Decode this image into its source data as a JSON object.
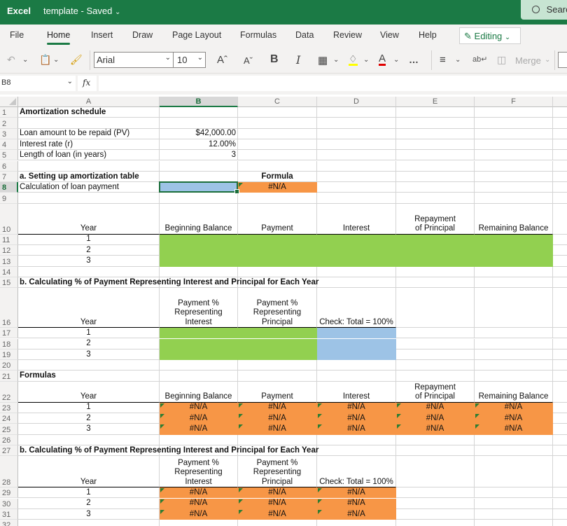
{
  "titlebar": {
    "app": "Excel",
    "doc_name": "template",
    "separator": "-",
    "status": "Saved",
    "search": "Search"
  },
  "tabs": [
    {
      "label": "File"
    },
    {
      "label": "Home",
      "active": true
    },
    {
      "label": "Insert"
    },
    {
      "label": "Draw"
    },
    {
      "label": "Page Layout"
    },
    {
      "label": "Formulas"
    },
    {
      "label": "Data"
    },
    {
      "label": "Review"
    },
    {
      "label": "View"
    },
    {
      "label": "Help"
    }
  ],
  "editing_mode": "Editing",
  "toolbar": {
    "font_name": "Arial",
    "font_size": "10",
    "bold": "B",
    "italic": "I",
    "more": "…",
    "merge": "Merge",
    "colors": {
      "highlight": "#ffff00",
      "font_color": "#e00000"
    }
  },
  "formula_bar": {
    "name_box": "B8",
    "fx": "fx",
    "content": ""
  },
  "columns": [
    "A",
    "B",
    "C",
    "D",
    "E",
    "F"
  ],
  "selected_cell": "B8",
  "colors": {
    "green_fill": "#92d050",
    "blue_fill": "#9dc3e6",
    "orange_fill": "#f79646",
    "excel_green": "#1b7a45"
  },
  "sheet": {
    "r1": {
      "A": "Amortization schedule"
    },
    "r3": {
      "A": "Loan amount to be repaid (PV)",
      "B": "$42,000.00"
    },
    "r4": {
      "A": "Interest rate  (r)",
      "B": "12.00%"
    },
    "r5": {
      "A": "Length of loan (in years)",
      "B": "3"
    },
    "r7": {
      "A": "a.  Setting up amortization table",
      "C": "Formula"
    },
    "r8": {
      "A": "Calculation of loan payment",
      "B": "",
      "C": "#N/A"
    },
    "r10": {
      "A": "Year",
      "B": "Beginning Balance",
      "C": "Payment",
      "D": "Interest",
      "E": "Repayment of Principal",
      "F": "Remaining Balance"
    },
    "r11": {
      "A": "1"
    },
    "r12": {
      "A": "2"
    },
    "r13": {
      "A": "3"
    },
    "r15": {
      "A": "b.  Calculating % of Payment Representing Interest and Principal for Each Year"
    },
    "r16": {
      "A": "Year",
      "B": "Payment % Representing Interest",
      "C": "Payment % Representing Principal",
      "D": "Check:  Total = 100%"
    },
    "r17": {
      "A": "1"
    },
    "r18": {
      "A": "2"
    },
    "r19": {
      "A": "3"
    },
    "r21": {
      "A": "Formulas"
    },
    "r22": {
      "A": "Year",
      "B": "Beginning Balance",
      "C": "Payment",
      "D": "Interest",
      "E": "Repayment of Principal",
      "F": "Remaining Balance"
    },
    "r23": {
      "A": "1",
      "B": "#N/A",
      "C": "#N/A",
      "D": "#N/A",
      "E": "#N/A",
      "F": "#N/A"
    },
    "r24": {
      "A": "2",
      "B": "#N/A",
      "C": "#N/A",
      "D": "#N/A",
      "E": "#N/A",
      "F": "#N/A"
    },
    "r25": {
      "A": "3",
      "B": "#N/A",
      "C": "#N/A",
      "D": "#N/A",
      "E": "#N/A",
      "F": "#N/A"
    },
    "r27": {
      "A": "b.  Calculating % of Payment Representing Interest and Principal for Each Year"
    },
    "r28": {
      "A": "Year",
      "B": "Payment % Representing Interest",
      "C": "Payment % Representing Principal",
      "D": "Check:  Total = 100%"
    },
    "r29": {
      "A": "1",
      "B": "#N/A",
      "C": "#N/A",
      "D": "#N/A"
    },
    "r30": {
      "A": "2",
      "B": "#N/A",
      "C": "#N/A",
      "D": "#N/A"
    },
    "r31": {
      "A": "3",
      "B": "#N/A",
      "C": "#N/A",
      "D": "#N/A"
    }
  }
}
